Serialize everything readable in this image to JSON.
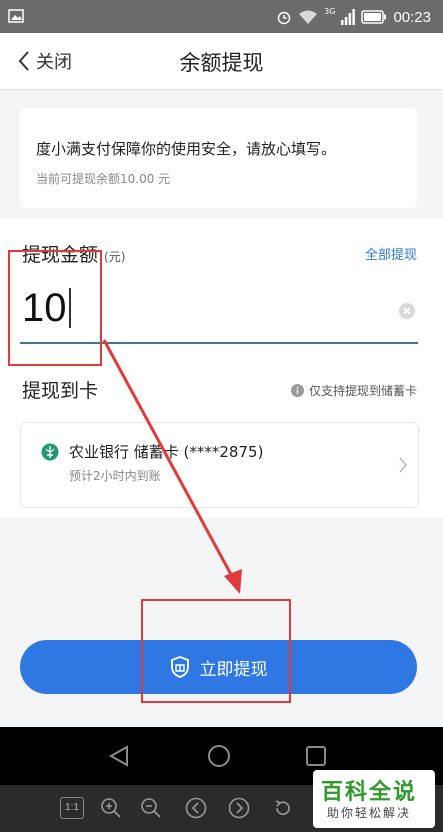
{
  "status_bar": {
    "network": "3G",
    "time": "00:23"
  },
  "nav": {
    "back_label": "关闭",
    "title": "余额提现"
  },
  "notice": {
    "main": "度小满支付保障你的使用安全，请放心填写。",
    "balance": "当前可提现余额10.00 元"
  },
  "amount": {
    "label": "提现金额",
    "unit": "(元)",
    "withdraw_all": "全部提现",
    "value": "10"
  },
  "card": {
    "title": "提现到卡",
    "hint": "仅支持提现到储蓄卡",
    "bank_name": "农业银行 储蓄卡 (****2875)",
    "eta": "预计2小时内到账"
  },
  "submit": {
    "label": "立即提现"
  },
  "watermark": {
    "main": "百科全说",
    "sub": "助你轻松解决"
  },
  "viewer": {
    "ratio_label": "1:1"
  },
  "colors": {
    "accent": "#2f78e4",
    "annotation": "#e23a3a",
    "watermark": "#2d9a2a"
  }
}
